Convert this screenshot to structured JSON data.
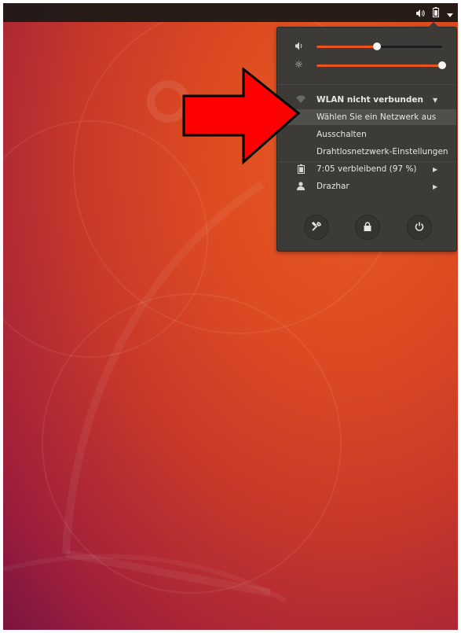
{
  "tray": {
    "volume_icon": "volume-icon",
    "battery_icon": "battery-icon",
    "menu_icon": "chevron-down-icon"
  },
  "menu": {
    "volume": {
      "icon": "speaker-icon",
      "level": 0.48
    },
    "brightness": {
      "icon": "brightness-icon",
      "level": 1.0
    },
    "wlan": {
      "icon": "wifi-icon",
      "label": "WLAN nicht verbunden",
      "items": [
        "Wählen Sie ein Netzwerk aus",
        "Ausschalten",
        "Drahtlosnetzwerk-Einstellungen"
      ]
    },
    "battery": {
      "icon": "battery-icon",
      "label": "7:05 verbleibend (97 %)"
    },
    "user": {
      "icon": "user-icon",
      "label": "Drazhar"
    },
    "actions": [
      {
        "icon": "settings-icon"
      },
      {
        "icon": "lock-icon"
      },
      {
        "icon": "power-icon"
      }
    ]
  },
  "colors": {
    "accent": "#e95420",
    "menu_bg": "#3c3b37",
    "arrow": "#ff0000"
  }
}
